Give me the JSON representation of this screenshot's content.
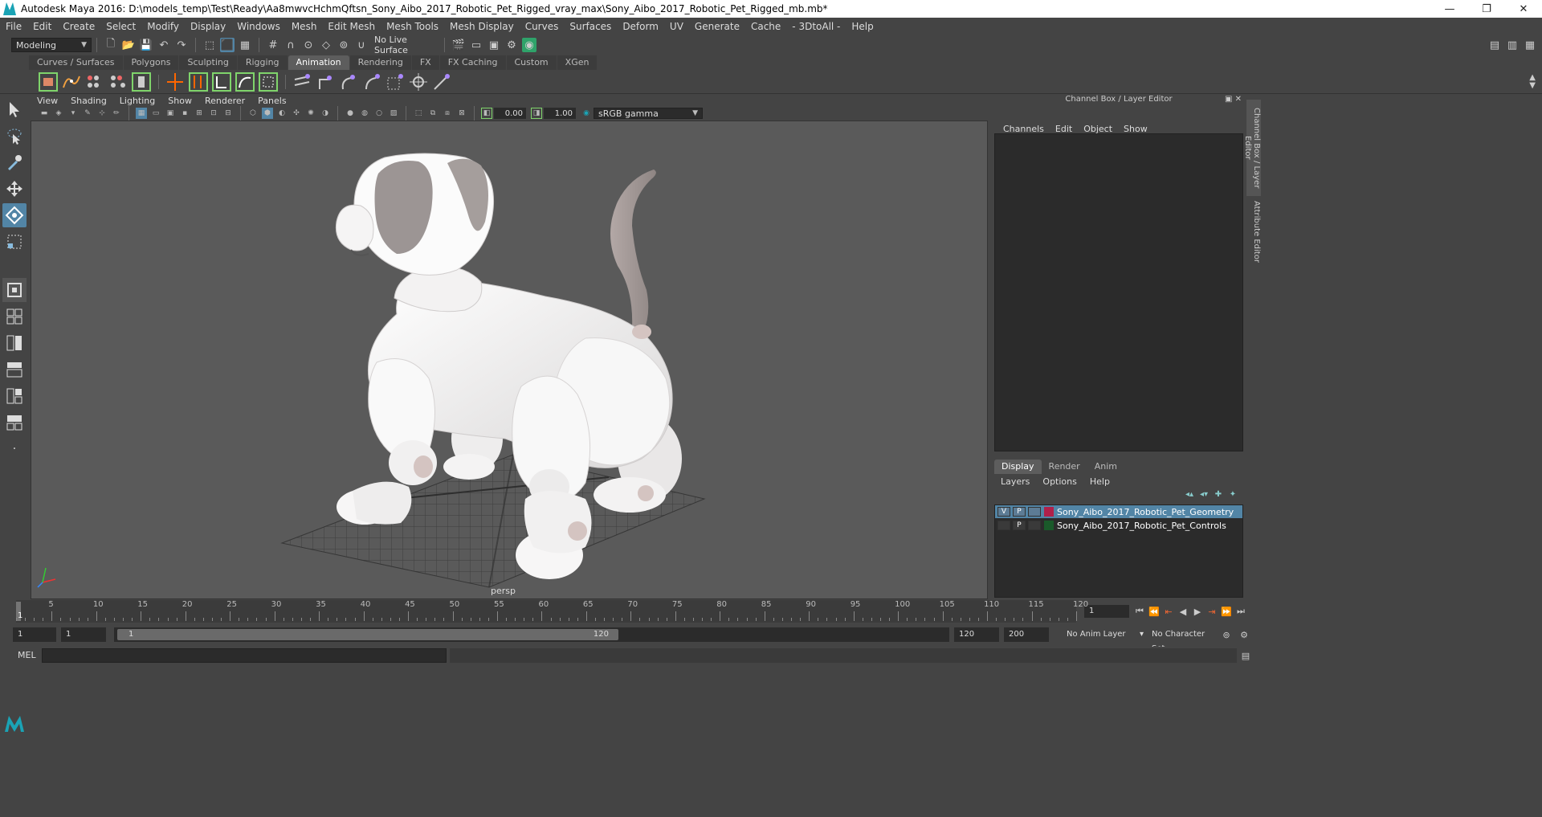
{
  "window": {
    "title": "Autodesk Maya 2016: D:\\models_temp\\Test\\Ready\\Aa8mwvcHchmQftsn_Sony_Aibo_2017_Robotic_Pet_Rigged_vray_max\\Sony_Aibo_2017_Robotic_Pet_Rigged_mb.mb*",
    "minimize": "—",
    "restore": "❐",
    "close": "✕"
  },
  "menubar": [
    "File",
    "Edit",
    "Create",
    "Select",
    "Modify",
    "Display",
    "Windows",
    "Mesh",
    "Edit Mesh",
    "Mesh Tools",
    "Mesh Display",
    "Curves",
    "Surfaces",
    "Deform",
    "UV",
    "Generate",
    "Cache",
    "- 3DtoAll -",
    "Help"
  ],
  "statusline": {
    "mode": "Modeling",
    "live_surface": "No Live Surface"
  },
  "shelf_tabs": [
    {
      "label": "Curves / Surfaces",
      "active": false
    },
    {
      "label": "Polygons",
      "active": false
    },
    {
      "label": "Sculpting",
      "active": false
    },
    {
      "label": "Rigging",
      "active": false
    },
    {
      "label": "Animation",
      "active": true
    },
    {
      "label": "Rendering",
      "active": false
    },
    {
      "label": "FX",
      "active": false
    },
    {
      "label": "FX Caching",
      "active": false
    },
    {
      "label": "Custom",
      "active": false
    },
    {
      "label": "XGen",
      "active": false
    }
  ],
  "panel_menu": [
    "View",
    "Shading",
    "Lighting",
    "Show",
    "Renderer",
    "Panels"
  ],
  "panel_toolbar": {
    "exposure": "0.00",
    "gamma": "1.00",
    "color_space": "sRGB gamma"
  },
  "viewport": {
    "camera": "persp",
    "background": "#5a5a5a"
  },
  "channel_box": {
    "header": "Channel Box / Layer Editor",
    "menu": [
      "Channels",
      "Edit",
      "Object",
      "Show"
    ]
  },
  "layer_editor": {
    "tabs": [
      {
        "label": "Display",
        "active": true
      },
      {
        "label": "Render",
        "active": false
      },
      {
        "label": "Anim",
        "active": false
      }
    ],
    "menu": [
      "Layers",
      "Options",
      "Help"
    ],
    "layers": [
      {
        "v": "V",
        "p": "P",
        "color": "#b0204a",
        "name": "Sony_Aibo_2017_Robotic_Pet_Geometry",
        "selected": true
      },
      {
        "v": "",
        "p": "P",
        "color": "#1a5a2a",
        "name": "Sony_Aibo_2017_Robotic_Pet_Controls",
        "selected": false
      }
    ]
  },
  "side_tabs": [
    "Channel Box / Layer Editor",
    "Attribute Editor"
  ],
  "timeslider": {
    "ticks": [
      "5",
      "10",
      "15",
      "20",
      "25",
      "30",
      "35",
      "40",
      "45",
      "50",
      "55",
      "60",
      "65",
      "70",
      "75",
      "80",
      "85",
      "90",
      "95",
      "100",
      "105",
      "110",
      "115",
      "120"
    ],
    "current_frame": "1",
    "current_field": "1"
  },
  "rangeslider": {
    "start": "1",
    "playback_start": "1",
    "handle_start": "1",
    "handle_end": "120",
    "playback_end": "120",
    "end": "200",
    "anim_layer": "No Anim Layer",
    "character_set": "No Character Set"
  },
  "cmdline": {
    "label": "MEL"
  }
}
